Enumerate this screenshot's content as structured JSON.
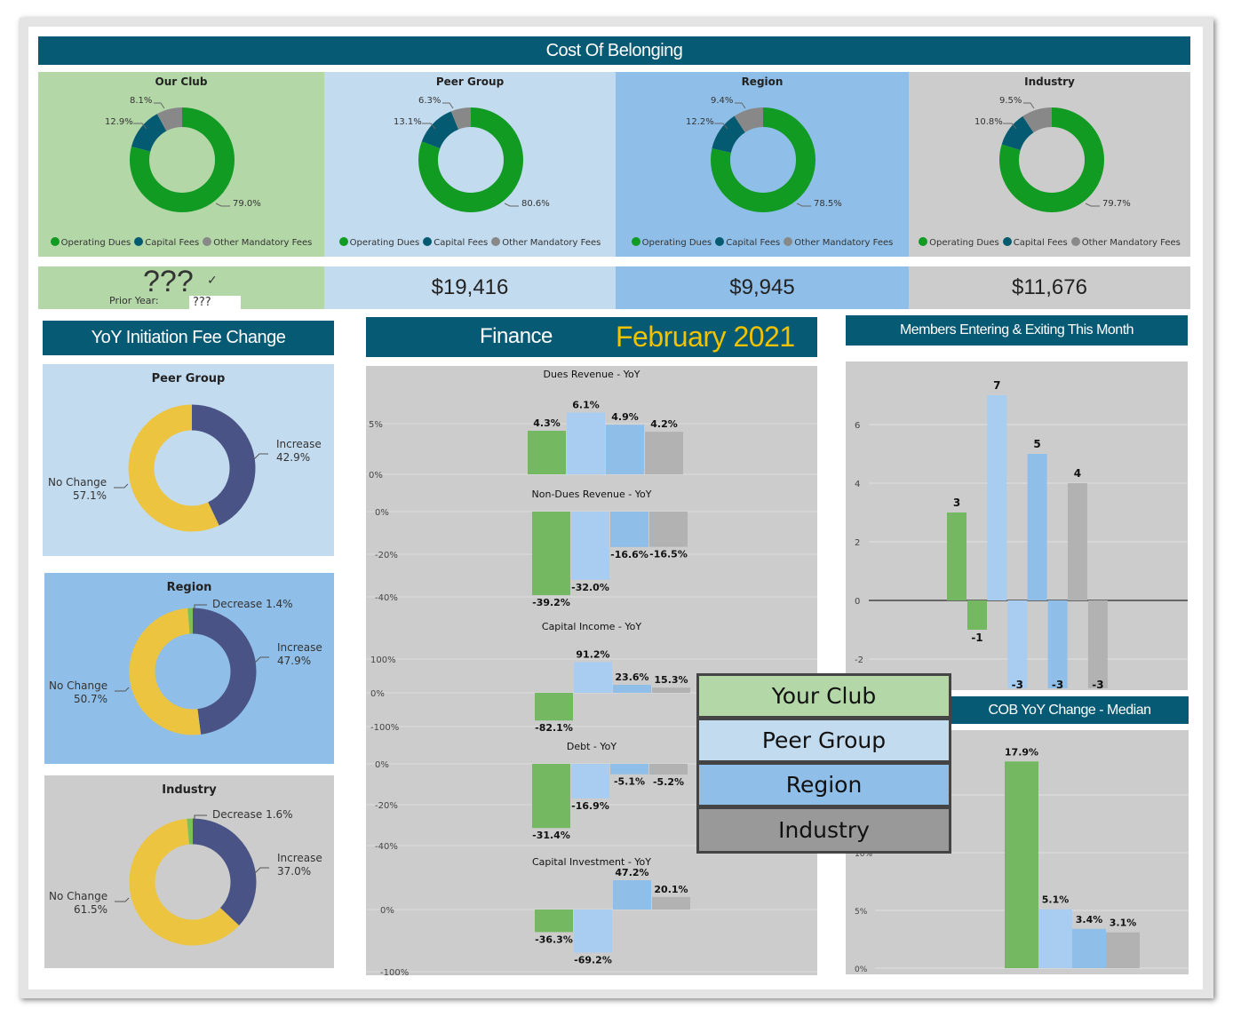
{
  "header": {
    "title": "Cost Of Belonging"
  },
  "colors": {
    "header": "#075a74",
    "our_club": "#b4d7a8",
    "peer_group": "#c3dbef",
    "region": "#8fbfe8",
    "industry": "#cccccc",
    "operating_dues": "#119b22",
    "capital_fees": "#045a70",
    "other_fees": "#888888",
    "increase": "#4a5385",
    "no_change": "#ecc440",
    "decrease": "#7cc05a",
    "accent_date": "#f2c200"
  },
  "legend": {
    "operating_dues": "Operating Dues",
    "capital_fees": "Capital Fees",
    "other_fees": "Other Mandatory Fees"
  },
  "cob_panels": [
    {
      "title": "Our Club",
      "operating": "79.0%",
      "capital": "12.9%",
      "other": "8.1%",
      "values": [
        79.0,
        12.9,
        8.1
      ]
    },
    {
      "title": "Peer Group",
      "operating": "80.6%",
      "capital": "13.1%",
      "other": "6.3%",
      "values": [
        80.6,
        13.1,
        6.3
      ]
    },
    {
      "title": "Region",
      "operating": "78.5%",
      "capital": "12.2%",
      "other": "9.4%",
      "values": [
        78.5,
        12.2,
        9.4
      ]
    },
    {
      "title": "Industry",
      "operating": "79.7%",
      "capital": "10.8%",
      "other": "9.5%",
      "values": [
        79.7,
        10.8,
        9.5
      ]
    }
  ],
  "totals": {
    "our_club": "???",
    "our_club_check": "✓",
    "prior_year_label": "Prior Year:",
    "prior_year_value": "???",
    "peer_group": "$19,416",
    "region": "$9,945",
    "industry": "$11,676"
  },
  "initiation": {
    "title": "YoY Initiation Fee Change",
    "panels": [
      {
        "title": "Peer Group",
        "increase": "Increase\n42.9%",
        "no_change": "No Change\n57.1%",
        "values": [
          42.9,
          57.1,
          0
        ]
      },
      {
        "title": "Region",
        "increase": "Increase\n47.9%",
        "no_change": "No Change\n50.7%",
        "decrease": "Decrease 1.4%",
        "values": [
          47.9,
          50.7,
          1.4
        ]
      },
      {
        "title": "Industry",
        "increase": "Increase\n37.0%",
        "no_change": "No Change\n61.5%",
        "decrease": "Decrease 1.6%",
        "values": [
          37.0,
          61.5,
          1.6
        ]
      }
    ]
  },
  "finance": {
    "title": "Finance",
    "date": "February 2021"
  },
  "chart_data": [
    {
      "type": "bar",
      "title": "Dues Revenue - YoY",
      "categories": [
        "Your Club",
        "Peer Group",
        "Region",
        "Industry"
      ],
      "values": [
        4.3,
        6.1,
        4.9,
        4.2
      ],
      "labels": [
        "4.3%",
        "6.1%",
        "4.9%",
        "4.2%"
      ],
      "ticks": [
        5,
        0
      ],
      "tick_labels": [
        "5%",
        "0%"
      ]
    },
    {
      "type": "bar",
      "title": "Non-Dues Revenue  - YoY",
      "categories": [
        "Your Club",
        "Peer Group",
        "Region",
        "Industry"
      ],
      "values": [
        -39.2,
        -32.0,
        -16.6,
        -16.5
      ],
      "labels": [
        "-39.2%",
        "-32.0%",
        "-16.6%",
        "-16.5%"
      ],
      "ticks": [
        0,
        -20,
        -40
      ],
      "tick_labels": [
        "0%",
        "-20%",
        "-40%"
      ]
    },
    {
      "type": "bar",
      "title": "Capital Income  - YoY",
      "categories": [
        "Your Club",
        "Peer Group",
        "Region",
        "Industry"
      ],
      "values": [
        -82.1,
        91.2,
        23.6,
        15.3
      ],
      "labels": [
        "-82.1%",
        "91.2%",
        "23.6%",
        "15.3%"
      ],
      "ticks": [
        100,
        0,
        -100
      ],
      "tick_labels": [
        "100%",
        "0%",
        "-100%"
      ]
    },
    {
      "type": "bar",
      "title": "Debt  - YoY",
      "categories": [
        "Your Club",
        "Peer Group",
        "Region",
        "Industry"
      ],
      "values": [
        -31.4,
        -16.9,
        -5.1,
        -5.2
      ],
      "labels": [
        "-31.4%",
        "-16.9%",
        "-5.1%",
        "-5.2%"
      ],
      "ticks": [
        0,
        -20,
        -40
      ],
      "tick_labels": [
        "0%",
        "-20%",
        "-40%"
      ]
    },
    {
      "type": "bar",
      "title": "Capital Investment  - YoY",
      "categories": [
        "Your Club",
        "Peer Group",
        "Region",
        "Industry"
      ],
      "values": [
        -36.3,
        -69.2,
        47.2,
        20.1
      ],
      "labels": [
        "-36.3%",
        "-69.2%",
        "47.2%",
        "20.1%"
      ],
      "ticks": [
        0,
        -100
      ],
      "tick_labels": [
        "0%",
        "-100%"
      ]
    },
    {
      "type": "bar",
      "title": "Members Entering & Exiting This Month",
      "categories": [
        "Your Club",
        "Peer Group",
        "Region",
        "Industry"
      ],
      "series": [
        {
          "values": [
            3,
            7,
            5,
            4
          ]
        },
        {
          "values": [
            -1,
            -3,
            -3,
            -3
          ]
        }
      ],
      "ticks": [
        6,
        4,
        2,
        0,
        -2
      ],
      "tick_labels": [
        "6",
        "4",
        "2",
        "0",
        "-2"
      ],
      "grid": true
    },
    {
      "type": "bar",
      "title": "COB YoY Change - Median",
      "categories": [
        "Your Club",
        "Peer Group",
        "Region",
        "Industry"
      ],
      "values": [
        17.9,
        5.1,
        3.4,
        3.1
      ],
      "labels": [
        "17.9%",
        "5.1%",
        "3.4%",
        "3.1%"
      ],
      "ticks": [
        10,
        5,
        0
      ],
      "tick_labels": [
        "10%",
        "5%",
        "0%"
      ],
      "ylim": [
        0,
        20
      ],
      "grid": true
    }
  ],
  "color_legend": [
    "Your Club",
    "Peer Group",
    "Region",
    "Industry"
  ]
}
